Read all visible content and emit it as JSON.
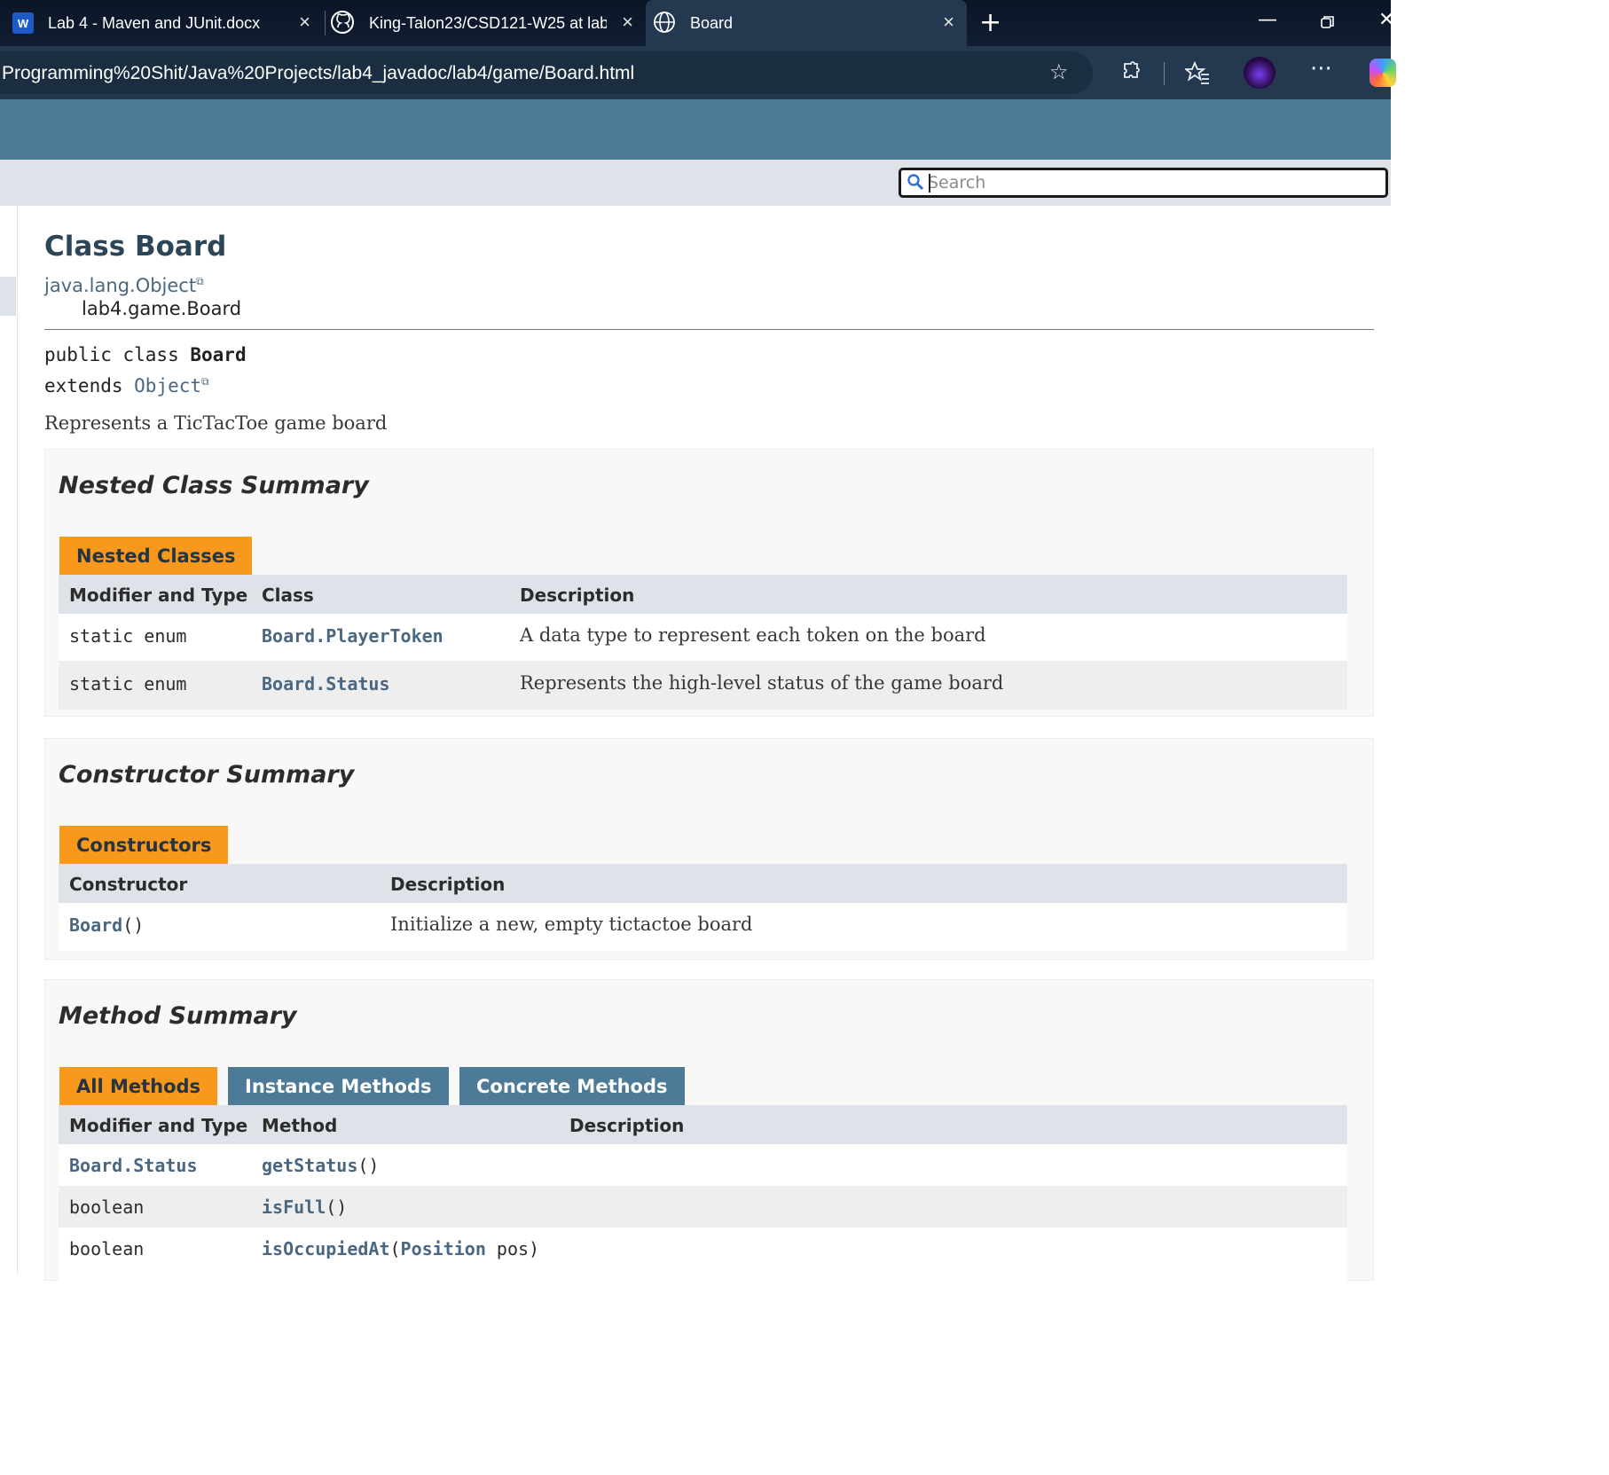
{
  "browser": {
    "tabs": [
      {
        "title": "Lab 4 - Maven and JUnit.docx",
        "icon": "word-icon"
      },
      {
        "title": "King-Talon23/CSD121-W25 at lab",
        "icon": "github-icon"
      },
      {
        "title": "Board",
        "icon": "globe-icon"
      }
    ],
    "new_tab_glyph": "+",
    "close_glyph": "×",
    "url": "Programming%20Shit/Java%20Projects/lab4_javadoc/lab4/game/Board.html"
  },
  "search": {
    "placeholder": "Search"
  },
  "page": {
    "class_title": "Class Board",
    "inheritance_parent": "java.lang.Object",
    "inheritance_child": "lab4.game.Board",
    "signature_line1_prefix": "public class ",
    "signature_line1_name": "Board",
    "signature_line2_prefix": "extends ",
    "signature_line2_link": "Object",
    "description": "Represents a TicTacToe game board"
  },
  "nested": {
    "title": "Nested Class Summary",
    "caption": "Nested Classes",
    "headers": [
      "Modifier and Type",
      "Class",
      "Description"
    ],
    "rows": [
      {
        "modifier": "static enum",
        "name": "Board.PlayerToken",
        "desc": "A data type to represent each token on the board"
      },
      {
        "modifier": "static enum",
        "name": "Board.Status",
        "desc": "Represents the high-level status of the game board"
      }
    ]
  },
  "constructors": {
    "title": "Constructor Summary",
    "caption": "Constructors",
    "headers": [
      "Constructor",
      "Description"
    ],
    "rows": [
      {
        "name": "Board",
        "params": "()",
        "desc": "Initialize a new, empty tictactoe board"
      }
    ]
  },
  "methods": {
    "title": "Method Summary",
    "tabs": [
      "All Methods",
      "Instance Methods",
      "Concrete Methods"
    ],
    "headers": [
      "Modifier and Type",
      "Method",
      "Description"
    ],
    "rows": [
      {
        "type": "Board.Status",
        "type_is_link": true,
        "name": "getStatus",
        "params_open": "(",
        "param_type": "",
        "param_rest": ")"
      },
      {
        "type": "boolean",
        "type_is_link": false,
        "name": "isFull",
        "params_open": "(",
        "param_type": "",
        "param_rest": ")"
      },
      {
        "type": "boolean",
        "type_is_link": false,
        "name": "isOccupiedAt",
        "params_open": "(",
        "param_type": "Position",
        "param_rest": " pos)"
      }
    ]
  },
  "colors": {
    "header_blue": "#4d7a97",
    "caption_orange": "#f8981d",
    "subnav_grey": "#dee3e9",
    "link": "#4a6782"
  }
}
